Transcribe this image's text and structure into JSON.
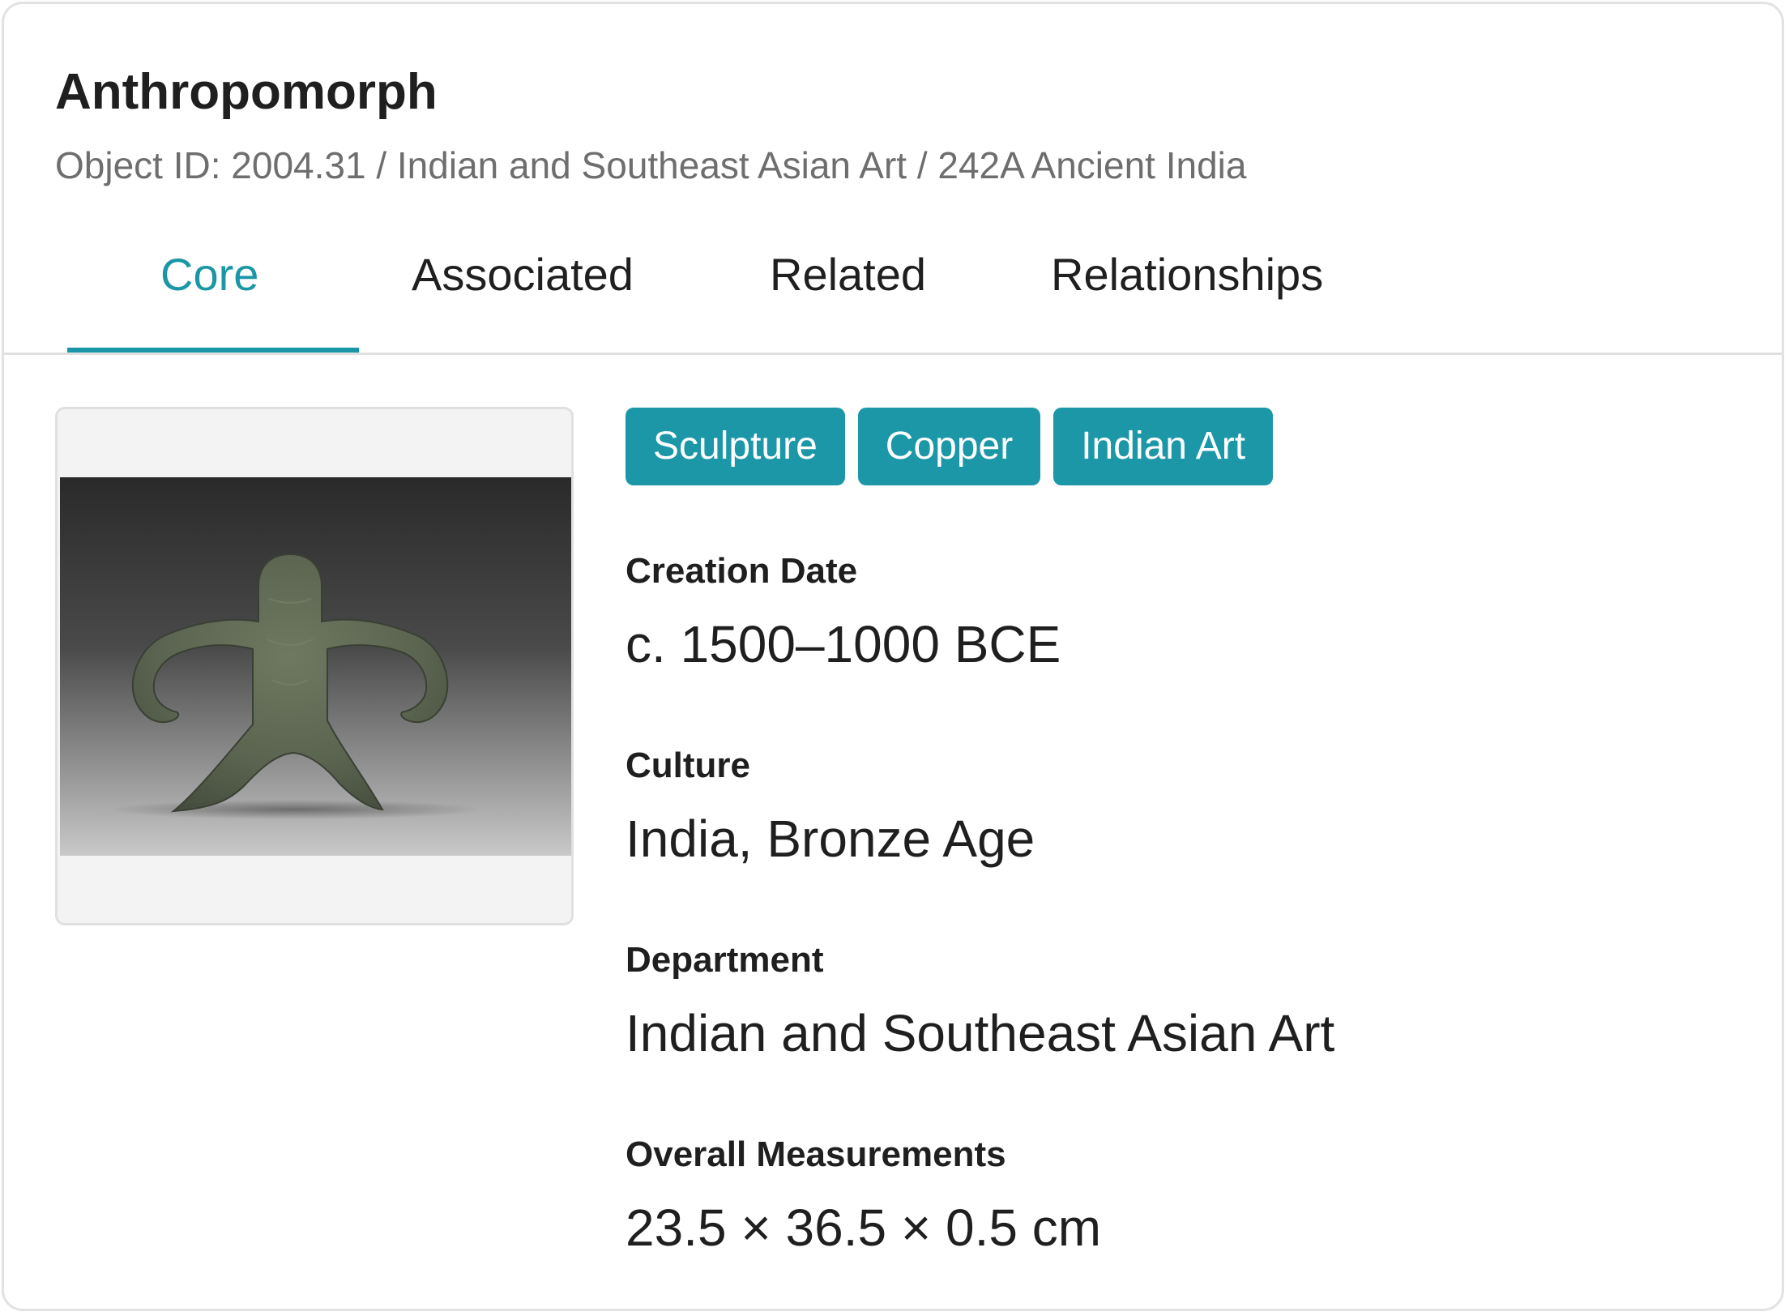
{
  "object": {
    "title": "Anthropomorph",
    "breadcrumb": "Object ID: 2004.31 / Indian and Southeast Asian Art / 242A Ancient India"
  },
  "tabs": [
    {
      "label": "Core",
      "active": true
    },
    {
      "label": "Associated",
      "active": false
    },
    {
      "label": "Related",
      "active": false
    },
    {
      "label": "Relationships",
      "active": false
    }
  ],
  "tags": [
    "Sculpture",
    "Copper",
    "Indian Art"
  ],
  "fields": [
    {
      "label": "Creation Date",
      "value": "c. 1500–1000 BCE"
    },
    {
      "label": "Culture",
      "value": "India, Bronze Age"
    },
    {
      "label": "Department",
      "value": "Indian and Southeast Asian Art"
    },
    {
      "label": "Overall Measurements",
      "value": "23.5 × 36.5 × 0.5 cm"
    }
  ],
  "colors": {
    "accent": "#1a96a6",
    "text": "#1f1f1f",
    "muted": "#6e6e6e"
  }
}
